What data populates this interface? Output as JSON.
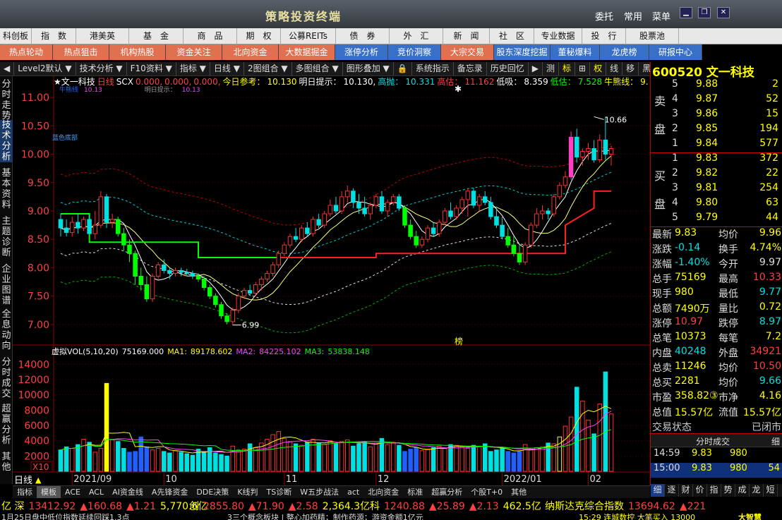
{
  "window": {
    "title": "策略投资终端",
    "nav_left": [
      "委托",
      "常用",
      "菜单"
    ],
    "controls": [
      "▣",
      "🗗",
      "✕"
    ]
  },
  "menu_row1": [
    "科创板",
    "指　数",
    "港美英",
    "基　金",
    "商　品",
    "期　权",
    "公募REITs",
    "债　券",
    "外　汇",
    "新　闻",
    "社　区",
    "专业数据",
    "投　行",
    "股票池"
  ],
  "menu_row2": [
    "热点轮动",
    "热点狙击",
    "机构热股",
    "资金关注",
    "北向资金",
    "大数据掘金",
    "涨停分析",
    "竞价洞察",
    "大宗交易",
    "股东深度挖掘",
    "董秘爆料",
    "龙虎榜",
    "研报中心"
  ],
  "toolbar": [
    "◀",
    "Level2默认 ▼",
    "技术分析 ▼",
    "F10资料 ▼",
    "指标 ▼",
    "日线 ▼",
    "2图组合 ▼",
    "多图组合 ▼",
    "图形叠加 ▼",
    "🔒",
    "系统指示",
    "备忘录",
    "历史回忆",
    "▶",
    "测",
    "标",
    "⊞",
    "权",
    "线",
    "移",
    "黑",
    "□",
    "▶"
  ],
  "left_nav": [
    "分时走势",
    "技术分析",
    "基本资料",
    "主题诊断",
    "企业图谱",
    "全息动向",
    "分时成交",
    "超赢分析",
    "其他"
  ],
  "indicator_line": {
    "name": "★文一科技",
    "period": "日线",
    "scx": "SCX",
    "v1": "0.000,",
    "v2": "0.000,",
    "v3": "0.000,",
    "ref_label": "今日参考：",
    "ref_val": "10.130",
    "hint_label": "明日提示：",
    "hint_val": "10.130,",
    "hp_label": "高抛：",
    "hp_val": "10.331",
    "gg_label": "高估：",
    "gg_val": "11.162",
    "dx_label": "低吸：",
    "dx_val": "8.359",
    "dg_label": "低估：",
    "dg_val": "7.528",
    "nx_label": "牛熊线：",
    "nx_val": "9."
  },
  "subline_small": [
    "牛熊线",
    "10.13",
    "明日提示：",
    "10.13"
  ],
  "price_axis": [
    "11.00",
    "10.50",
    "10.00",
    "9.50",
    "9.00",
    "8.50",
    "8.00",
    "7.50",
    "7.00"
  ],
  "annotations": {
    "high": "10.66",
    "low": "6.99",
    "blue_sky": "蓝色底部",
    "bang": "榜"
  },
  "volume_header": {
    "name": "虚拟VOL(5,10,20)",
    "vol": "75169.000",
    "ma1_label": "MA1:",
    "ma1": "89178.602",
    "ma2_label": "MA2:",
    "ma2": "84225.102",
    "ma3_label": "MA3:",
    "ma3": "53838.148"
  },
  "volume_axis": [
    "14000",
    "12000",
    "10000",
    "8000",
    "6000",
    "4000",
    "2000"
  ],
  "volume_unit": "X10",
  "date_axis": [
    "2021/09",
    "10",
    "11",
    "12",
    "2022/01",
    "02"
  ],
  "period_label": "日线",
  "chart_data": {
    "type": "candlestick",
    "ylim": [
      6.7,
      11.2
    ],
    "ohlc": [
      [
        8.85,
        8.95,
        8.55,
        8.7
      ],
      [
        8.7,
        8.85,
        8.55,
        8.62
      ],
      [
        8.62,
        8.9,
        8.55,
        8.8
      ],
      [
        8.8,
        8.95,
        8.6,
        8.7
      ],
      [
        8.7,
        8.9,
        8.65,
        8.85
      ],
      [
        8.85,
        8.95,
        8.7,
        8.6
      ],
      [
        8.6,
        9.0,
        8.5,
        8.75
      ],
      [
        8.75,
        9.35,
        8.7,
        9.25
      ],
      [
        9.25,
        9.3,
        8.7,
        8.8
      ],
      [
        8.8,
        8.95,
        8.7,
        8.85
      ],
      [
        8.85,
        8.9,
        8.55,
        8.6
      ],
      [
        8.6,
        8.7,
        8.3,
        8.4
      ],
      [
        8.4,
        8.5,
        8.1,
        8.25
      ],
      [
        8.25,
        8.3,
        7.7,
        7.85
      ],
      [
        7.85,
        8.0,
        7.6,
        7.7
      ],
      [
        7.7,
        7.85,
        7.4,
        7.45
      ],
      [
        7.45,
        7.9,
        7.4,
        7.85
      ],
      [
        7.85,
        8.1,
        7.8,
        8.05
      ],
      [
        8.05,
        8.15,
        7.9,
        7.95
      ],
      [
        7.95,
        8.0,
        7.8,
        7.9
      ],
      [
        7.9,
        8.0,
        7.85,
        7.95
      ],
      [
        7.95,
        8.0,
        7.85,
        7.92
      ],
      [
        7.92,
        7.98,
        7.85,
        7.9
      ],
      [
        7.9,
        7.95,
        7.8,
        7.85
      ],
      [
        7.85,
        7.9,
        7.75,
        7.8
      ],
      [
        7.8,
        7.85,
        7.6,
        7.65
      ],
      [
        7.65,
        7.7,
        7.45,
        7.5
      ],
      [
        7.5,
        7.55,
        7.3,
        7.35
      ],
      [
        7.35,
        7.4,
        7.1,
        7.15
      ],
      [
        7.15,
        7.2,
        7.0,
        7.05
      ],
      [
        7.05,
        7.3,
        6.99,
        7.25
      ],
      [
        7.25,
        7.55,
        7.2,
        7.5
      ],
      [
        7.5,
        7.65,
        7.45,
        7.6
      ],
      [
        7.6,
        7.7,
        7.5,
        7.55
      ],
      [
        7.55,
        7.75,
        7.5,
        7.7
      ],
      [
        7.7,
        7.85,
        7.6,
        7.8
      ],
      [
        7.8,
        7.95,
        7.75,
        7.9
      ],
      [
        7.9,
        8.1,
        7.85,
        8.05
      ],
      [
        8.05,
        8.3,
        8.0,
        8.25
      ],
      [
        8.25,
        8.45,
        8.2,
        8.4
      ],
      [
        8.4,
        8.6,
        8.35,
        8.55
      ],
      [
        8.55,
        8.7,
        8.45,
        8.5
      ],
      [
        8.5,
        8.75,
        8.45,
        8.7
      ],
      [
        8.7,
        8.8,
        8.55,
        8.6
      ],
      [
        8.6,
        8.9,
        8.55,
        8.85
      ],
      [
        8.85,
        8.95,
        8.7,
        8.75
      ],
      [
        8.75,
        9.0,
        8.7,
        8.95
      ],
      [
        8.95,
        9.2,
        8.9,
        9.1
      ],
      [
        9.1,
        9.25,
        8.95,
        9.0
      ],
      [
        9.0,
        9.35,
        8.95,
        9.25
      ],
      [
        9.25,
        9.45,
        9.15,
        9.35
      ],
      [
        9.35,
        9.4,
        9.05,
        9.15
      ],
      [
        9.15,
        9.3,
        8.95,
        9.05
      ],
      [
        9.05,
        9.25,
        8.9,
        8.95
      ],
      [
        8.95,
        9.15,
        8.85,
        9.1
      ],
      [
        9.1,
        9.3,
        9.05,
        9.25
      ],
      [
        9.25,
        9.35,
        8.95,
        9.0
      ],
      [
        9.0,
        9.2,
        8.9,
        9.15
      ],
      [
        9.15,
        9.3,
        9.1,
        9.25
      ],
      [
        9.25,
        9.3,
        9.0,
        9.05
      ],
      [
        9.05,
        9.1,
        8.7,
        8.75
      ],
      [
        8.75,
        8.85,
        8.5,
        8.55
      ],
      [
        8.55,
        8.65,
        8.35,
        8.4
      ],
      [
        8.4,
        8.55,
        8.35,
        8.5
      ],
      [
        8.5,
        8.75,
        8.45,
        8.7
      ],
      [
        8.7,
        8.8,
        8.55,
        8.6
      ],
      [
        8.6,
        8.85,
        8.55,
        8.8
      ],
      [
        8.8,
        9.05,
        8.75,
        9.0
      ],
      [
        9.0,
        9.15,
        8.85,
        8.9
      ],
      [
        8.9,
        9.1,
        8.85,
        9.05
      ],
      [
        9.05,
        9.25,
        8.95,
        9.2
      ],
      [
        9.2,
        9.4,
        8.9,
        9.35
      ],
      [
        9.35,
        9.4,
        9.05,
        9.1
      ],
      [
        9.1,
        9.3,
        9.0,
        9.25
      ],
      [
        9.25,
        9.35,
        9.1,
        9.15
      ],
      [
        9.15,
        9.25,
        8.85,
        8.9
      ],
      [
        8.9,
        9.05,
        8.7,
        8.75
      ],
      [
        8.75,
        8.9,
        8.5,
        8.55
      ],
      [
        8.55,
        8.7,
        8.35,
        8.4
      ],
      [
        8.4,
        8.55,
        8.2,
        8.25
      ],
      [
        8.25,
        8.4,
        8.05,
        8.1
      ],
      [
        8.1,
        8.45,
        8.05,
        8.4
      ],
      [
        8.4,
        8.8,
        8.35,
        8.75
      ],
      [
        8.75,
        9.05,
        8.7,
        8.95
      ],
      [
        8.95,
        9.1,
        8.85,
        9.0
      ],
      [
        9.0,
        9.05,
        8.85,
        8.95
      ],
      [
        8.95,
        9.3,
        8.9,
        9.25
      ],
      [
        9.25,
        9.5,
        9.2,
        9.45
      ],
      [
        9.45,
        9.7,
        9.4,
        9.6
      ],
      [
        9.6,
        10.4,
        9.55,
        10.3
      ],
      [
        10.3,
        10.45,
        9.85,
        9.95
      ],
      [
        9.95,
        10.1,
        9.8,
        10.05
      ],
      [
        10.05,
        10.2,
        9.9,
        10.1
      ],
      [
        10.1,
        10.25,
        9.85,
        9.9
      ],
      [
        9.9,
        10.35,
        9.85,
        10.25
      ],
      [
        10.25,
        10.66,
        9.9,
        10.0
      ],
      [
        10.0,
        10.15,
        9.8,
        10.1
      ]
    ],
    "wave_dates": [
      "2021/09",
      "10",
      "11",
      "12",
      "2022/01",
      "02"
    ],
    "volumes": [
      2800,
      3200,
      3000,
      3500,
      4200,
      3800,
      2500,
      3000,
      11500,
      4100,
      3900,
      3000,
      2500,
      2600,
      4500,
      3200,
      2800,
      3000,
      2600,
      2400,
      2700,
      2500,
      2300,
      2100,
      2900,
      2600,
      3100,
      2400,
      2200,
      2000,
      3300,
      2800,
      2900,
      3600,
      3100,
      3700,
      4200,
      4800,
      5200,
      4300,
      3900,
      3600,
      3400,
      3800,
      4200,
      3700,
      3500,
      4000,
      3600,
      3900,
      4100,
      3300,
      3600,
      3900,
      3200,
      3700,
      4300,
      3500,
      3800,
      3400,
      2600,
      2900,
      3100,
      2700,
      2900,
      3100,
      3300,
      3000,
      3500,
      3400,
      3200,
      3000,
      3400,
      3300,
      3600,
      2600,
      2800,
      3000,
      2600,
      2400,
      2600,
      3500,
      2900,
      3100,
      3200,
      3700,
      3600,
      4500,
      5900,
      7100,
      11000,
      9200,
      6700,
      4900,
      8800,
      13000,
      7500
    ]
  },
  "right_panel": {
    "code": "600520",
    "name": "文一科技",
    "sell": [
      {
        "lvl": "5",
        "price": "9.88",
        "vol": "2"
      },
      {
        "lvl": "4",
        "price": "9.87",
        "vol": "52"
      },
      {
        "lvl": "3",
        "price": "9.86",
        "vol": "15"
      },
      {
        "lvl": "2",
        "price": "9.85",
        "vol": "194"
      },
      {
        "lvl": "1",
        "price": "9.84",
        "vol": "577"
      }
    ],
    "buy": [
      {
        "lvl": "1",
        "price": "9.83",
        "vol": "372"
      },
      {
        "lvl": "2",
        "price": "9.82",
        "vol": "22"
      },
      {
        "lvl": "3",
        "price": "9.81",
        "vol": "254"
      },
      {
        "lvl": "4",
        "price": "9.80",
        "vol": "63"
      },
      {
        "lvl": "5",
        "price": "9.79",
        "vol": "44"
      }
    ],
    "sell_label": [
      "卖",
      "盘"
    ],
    "buy_label": [
      "买",
      "盘"
    ],
    "quote": [
      [
        "最新",
        "9.83",
        "均价",
        "9.96"
      ],
      [
        "涨跌",
        "-0.14",
        "换手",
        "4.74%"
      ],
      [
        "涨幅",
        "-1.40%",
        "今开",
        "9.97"
      ],
      [
        "总手",
        "75169",
        "最高",
        "10.33"
      ],
      [
        "现手",
        "980",
        "最低",
        "9.77"
      ],
      [
        "总额",
        "7490万",
        "量比",
        "0.72"
      ],
      [
        "涨停",
        "10.97",
        "跌停",
        "8.97"
      ],
      [
        "总笔",
        "10373",
        "每笔",
        "7.2"
      ],
      [
        "内盘",
        "40248",
        "外盘",
        "34921"
      ],
      [
        "总卖",
        "11246",
        "均价",
        "10.50"
      ],
      [
        "总买",
        "2281",
        "均价",
        "9.66"
      ],
      [
        "市盈",
        "358.82③",
        "市净",
        "4.16"
      ],
      [
        "总值",
        "15.57亿",
        "流值",
        "15.57亿"
      ]
    ],
    "trade_status_label": "交易状态",
    "trade_status": "已闭市",
    "ticks_title": "分时成交",
    "ticks_right": "细",
    "ticks": [
      [
        "14:59",
        "9.83",
        "980",
        ""
      ],
      [
        "15:00",
        "9.83",
        "980",
        "54"
      ]
    ],
    "bottom_tabs": [
      "细",
      "逐",
      "财",
      "价",
      "指",
      "势",
      "成",
      "龙",
      "短"
    ]
  },
  "bottom_tabs": [
    "指标",
    "模板",
    "ACE",
    "ACL",
    "AI资金线",
    "A先锋资金",
    "DDE决策",
    "K线判",
    "TS诊断",
    "W五步战法",
    "act",
    "北向资金",
    "标准",
    "超赢分析",
    "个股T+0",
    "其他"
  ],
  "ticker": [
    {
      "label": "亿 深",
      "val": "13412.92",
      "chg": "▲160.68",
      "pct": "▲1.21",
      "amt": "5,770.6亿"
    },
    {
      "label": "创",
      "val": "2855.80",
      "chg": "▲71.90",
      "pct": "▲2.58",
      "amt": "2,364.3亿"
    },
    {
      "label": "科",
      "val": "1240.88",
      "chg": "▲25.89",
      "pct": "▲2.13",
      "amt": "462.5亿"
    },
    {
      "label": "纳斯达克综合指数",
      "val": "13694.62",
      "chg": "▲221",
      "pct": "",
      "amt": ""
    }
  ],
  "status_left": "1月25日盘中低位指数延续回踩1.3点",
  "status_mid": "3三个概念板块 | 整心加药精；制作药源；游资金额1亿元",
  "status_right": "15:29 连城数控 大笔买入 13000",
  "logo": "大智慧",
  "colors": {
    "up": "#ff3030",
    "down": "#00e0e0",
    "up2": "#ff3030",
    "green": "#00ff00",
    "yellow": "#ffff00",
    "magenta": "#ff40ff",
    "white": "#ffffff",
    "grid_red": "#8a0000"
  }
}
